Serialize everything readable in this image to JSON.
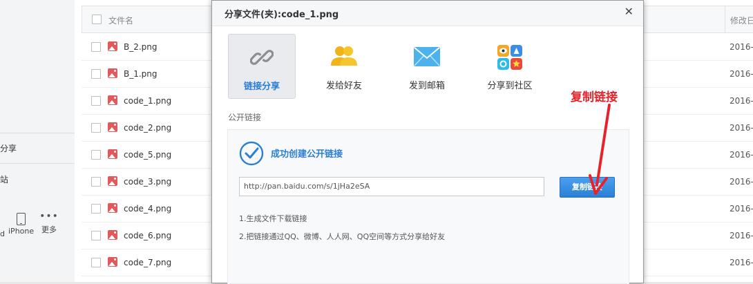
{
  "sidebar": {
    "share_partial": "分享",
    "recycle_partial": "站",
    "device_partial": "d",
    "iphone_label": "iPhone",
    "more_label": "更多"
  },
  "filelist": {
    "header_name": "文件名",
    "header_date": "修改日",
    "rows": [
      {
        "name": "B_2.png",
        "date": "2016-0"
      },
      {
        "name": "B_1.png",
        "date": "2016-0"
      },
      {
        "name": "code_1.png",
        "date": "2016-0"
      },
      {
        "name": "code_2.png",
        "date": "2016-0"
      },
      {
        "name": "code_5.png",
        "date": "2016-0"
      },
      {
        "name": "code_3.png",
        "date": "2016-0"
      },
      {
        "name": "code_4.png",
        "date": "2016-0"
      },
      {
        "name": "code_6.png",
        "date": "2016-0"
      },
      {
        "name": "code_7.png",
        "date": "2016-0"
      }
    ]
  },
  "dialog": {
    "title": "分享文件(夹):code_1.png",
    "tabs": [
      {
        "label": "链接分享",
        "icon": "link-icon"
      },
      {
        "label": "发给好友",
        "icon": "friends-icon"
      },
      {
        "label": "发到邮箱",
        "icon": "mail-icon"
      },
      {
        "label": "分享到社区",
        "icon": "community-icon"
      }
    ],
    "section_label": "公开链接",
    "success_text": "成功创建公开链接",
    "link_value": "http://pan.baidu.com/s/1jHa2eSA",
    "copy_button": "复制链接",
    "note1": "1.生成文件下载链接",
    "note2": "2.把链接通过QQ、微博、人人网、QQ空间等方式分享给好友"
  },
  "annotation": {
    "text": "复制链接",
    "color": "#e8222a"
  },
  "colors": {
    "accent": "#2a7fd4",
    "file_icon": "#e2595b"
  }
}
